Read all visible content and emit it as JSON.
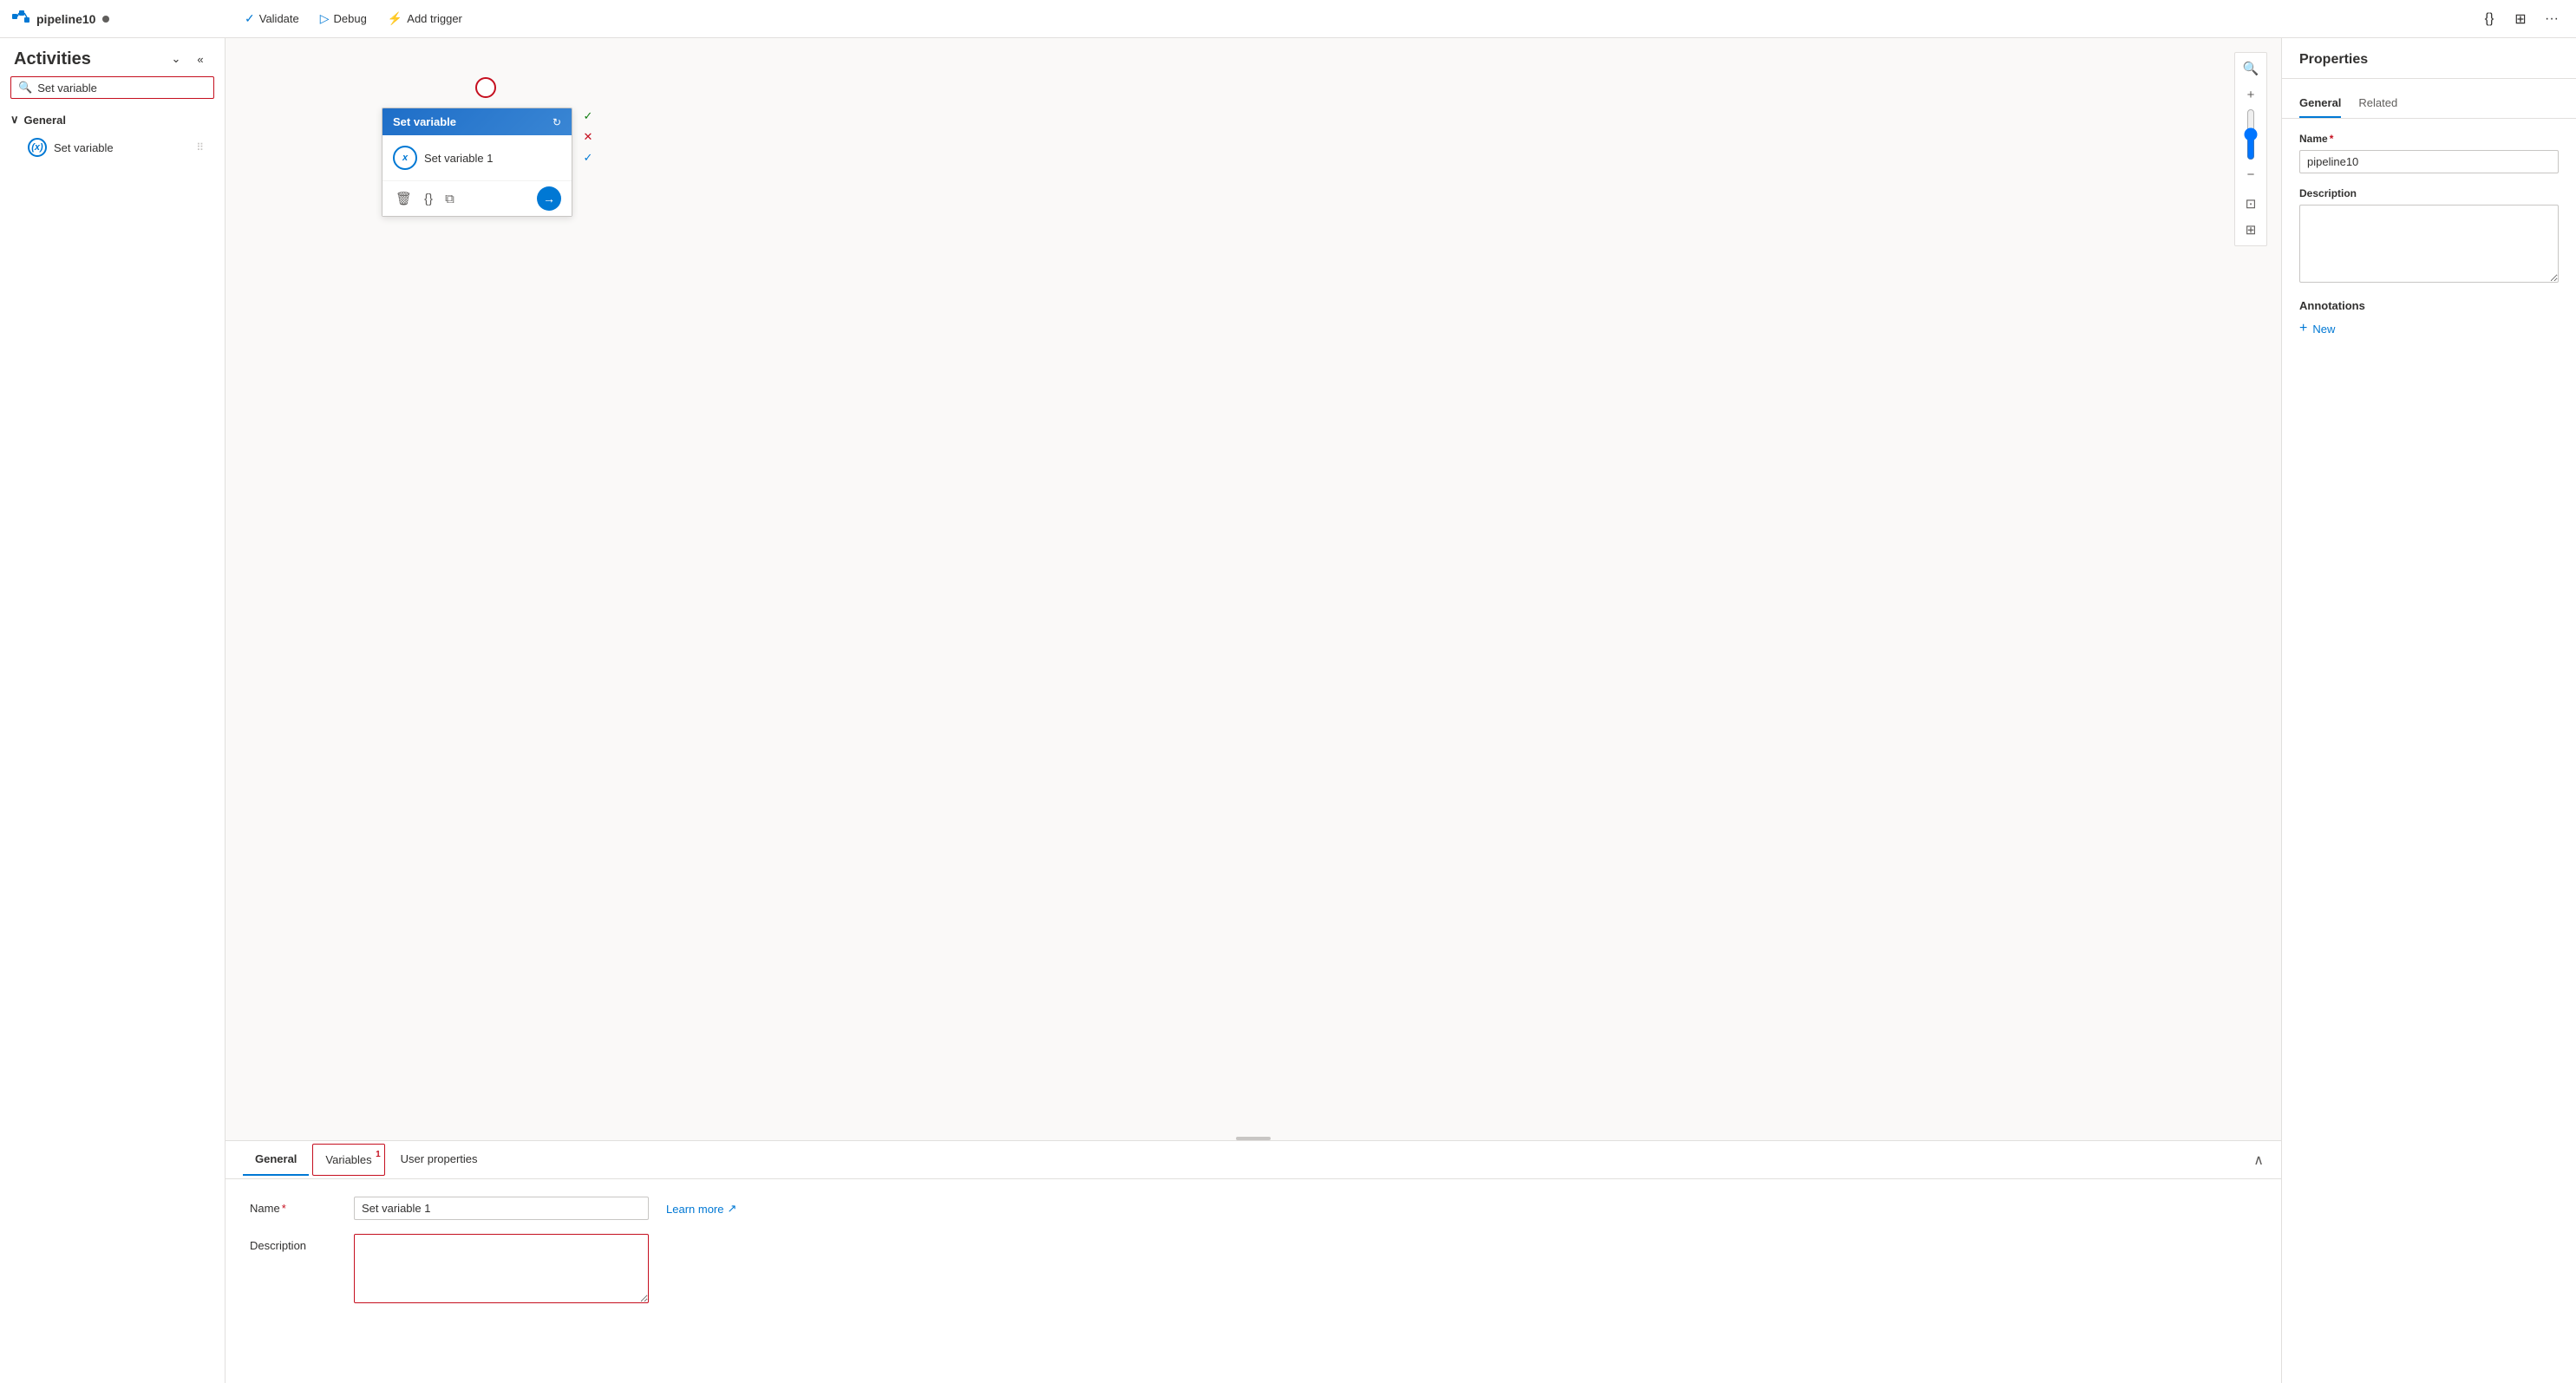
{
  "topbar": {
    "pipeline_name": "pipeline10",
    "dot_color": "#605e5c",
    "validate_label": "Validate",
    "debug_label": "Debug",
    "add_trigger_label": "Add trigger"
  },
  "activities_panel": {
    "title": "Activities",
    "search_placeholder": "Set variable",
    "search_value": "Set variable",
    "general_section": "General",
    "items": [
      {
        "label": "Set variable",
        "icon": "(x)"
      }
    ]
  },
  "canvas": {
    "node": {
      "header": "Set variable",
      "body_label": "Set variable 1",
      "body_icon": "(x)"
    }
  },
  "bottom_panel": {
    "tabs": [
      {
        "label": "General",
        "badge": null,
        "active": true
      },
      {
        "label": "Variables",
        "badge": "1",
        "outlined": true
      },
      {
        "label": "User properties",
        "badge": null
      }
    ],
    "name_label": "Name",
    "name_required": "*",
    "name_value": "Set variable 1",
    "learn_more_label": "Learn more",
    "description_label": "Description",
    "description_value": ""
  },
  "properties_panel": {
    "title": "Properties",
    "tabs": [
      {
        "label": "General",
        "active": true
      },
      {
        "label": "Related"
      }
    ],
    "name_label": "Name",
    "name_required": "*",
    "name_value": "pipeline10",
    "description_label": "Description",
    "description_value": "",
    "annotations_title": "Annotations",
    "new_label": "New"
  }
}
